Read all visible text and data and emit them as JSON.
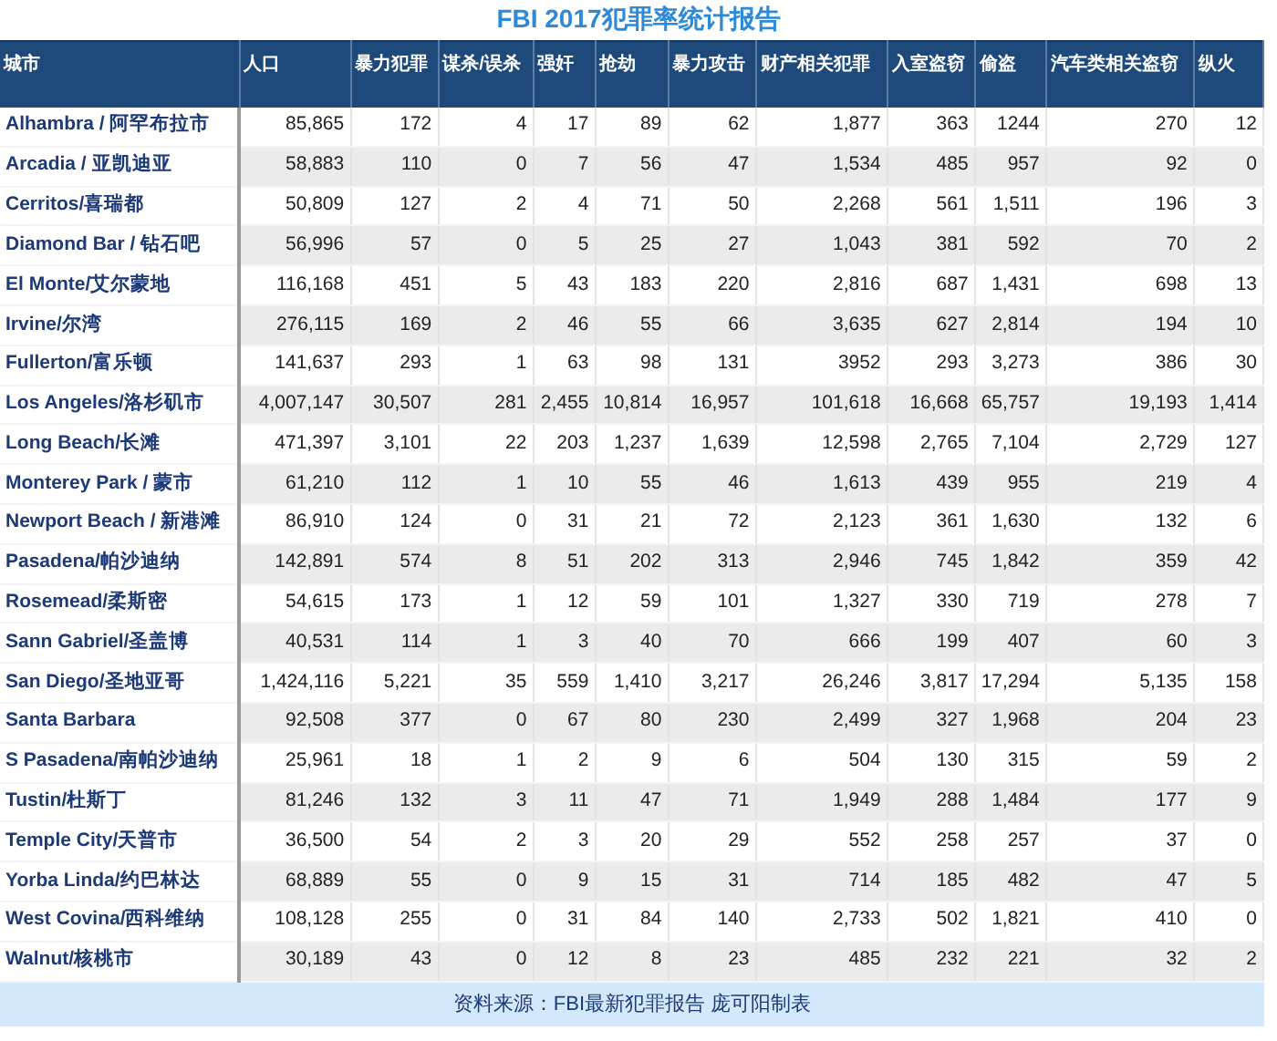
{
  "title": "FBI 2017犯罪率统计报告",
  "table": {
    "columns": [
      "城市",
      "人口",
      "暴力犯罪",
      "谋杀/误杀",
      "强奸",
      "抢劫",
      "暴力攻击",
      "财产相关犯罪",
      "入室盗窃",
      "偷盗",
      "汽车类相关盗窃",
      "纵火"
    ],
    "rows": [
      [
        "Alhambra / 阿罕布拉市",
        "85,865",
        "172",
        "4",
        "17",
        "89",
        "62",
        "1,877",
        "363",
        "1244",
        "270",
        "12"
      ],
      [
        "Arcadia / 亚凯迪亚",
        "58,883",
        "110",
        "0",
        "7",
        "56",
        "47",
        "1,534",
        "485",
        "957",
        "92",
        "0"
      ],
      [
        "Cerritos/喜瑞都",
        "50,809",
        "127",
        "2",
        "4",
        "71",
        "50",
        "2,268",
        "561",
        "1,511",
        "196",
        "3"
      ],
      [
        "Diamond Bar / 钻石吧",
        "56,996",
        "57",
        "0",
        "5",
        "25",
        "27",
        "1,043",
        "381",
        "592",
        "70",
        "2"
      ],
      [
        "El Monte/艾尔蒙地",
        "116,168",
        "451",
        "5",
        "43",
        "183",
        "220",
        "2,816",
        "687",
        "1,431",
        "698",
        "13"
      ],
      [
        "Irvine/尔湾",
        "276,115",
        "169",
        "2",
        "46",
        "55",
        "66",
        "3,635",
        "627",
        "2,814",
        "194",
        "10"
      ],
      [
        "Fullerton/富乐顿",
        "141,637",
        "293",
        "1",
        "63",
        "98",
        "131",
        "3952",
        "293",
        "3,273",
        "386",
        "30"
      ],
      [
        "Los Angeles/洛杉矶市",
        "4,007,147",
        "30,507",
        "281",
        "2,455",
        "10,814",
        "16,957",
        "101,618",
        "16,668",
        "65,757",
        "19,193",
        "1,414"
      ],
      [
        "Long Beach/长滩",
        "471,397",
        "3,101",
        "22",
        "203",
        "1,237",
        "1,639",
        "12,598",
        "2,765",
        "7,104",
        "2,729",
        "127"
      ],
      [
        "Monterey Park / 蒙市",
        "61,210",
        "112",
        "1",
        "10",
        "55",
        "46",
        "1,613",
        "439",
        "955",
        "219",
        "4"
      ],
      [
        "Newport Beach / 新港滩",
        "86,910",
        "124",
        "0",
        "31",
        "21",
        "72",
        "2,123",
        "361",
        "1,630",
        "132",
        "6"
      ],
      [
        "Pasadena/帕沙迪纳",
        "142,891",
        "574",
        "8",
        "51",
        "202",
        "313",
        "2,946",
        "745",
        "1,842",
        "359",
        "42"
      ],
      [
        "Rosemead/柔斯密",
        "54,615",
        "173",
        "1",
        "12",
        "59",
        "101",
        "1,327",
        "330",
        "719",
        "278",
        "7"
      ],
      [
        "Sann Gabriel/圣盖博",
        "40,531",
        "114",
        "1",
        "3",
        "40",
        "70",
        "666",
        "199",
        "407",
        "60",
        "3"
      ],
      [
        "San Diego/圣地亚哥",
        "1,424,116",
        "5,221",
        "35",
        "559",
        "1,410",
        "3,217",
        "26,246",
        "3,817",
        "17,294",
        "5,135",
        "158"
      ],
      [
        "Santa Barbara",
        "92,508",
        "377",
        "0",
        "67",
        "80",
        "230",
        "2,499",
        "327",
        "1,968",
        "204",
        "23"
      ],
      [
        "S Pasadena/南帕沙迪纳",
        "25,961",
        "18",
        "1",
        "2",
        "9",
        "6",
        "504",
        "130",
        "315",
        "59",
        "2"
      ],
      [
        "Tustin/杜斯丁",
        "81,246",
        "132",
        "3",
        "11",
        "47",
        "71",
        "1,949",
        "288",
        "1,484",
        "177",
        "9"
      ],
      [
        "Temple City/天普市",
        "36,500",
        "54",
        "2",
        "3",
        "20",
        "29",
        "552",
        "258",
        "257",
        "37",
        "0"
      ],
      [
        "Yorba Linda/约巴林达",
        "68,889",
        "55",
        "0",
        "9",
        "15",
        "31",
        "714",
        "185",
        "482",
        "47",
        "5"
      ],
      [
        "West Covina/西科维纳",
        "108,128",
        "255",
        "0",
        "31",
        "84",
        "140",
        "2,733",
        "502",
        "1,821",
        "410",
        "0"
      ],
      [
        "Walnut/核桃市",
        "30,189",
        "43",
        "0",
        "12",
        "8",
        "23",
        "485",
        "232",
        "221",
        "32",
        "2"
      ]
    ]
  },
  "footer": "资料来源：FBI最新犯罪报告 庞可阳制表"
}
